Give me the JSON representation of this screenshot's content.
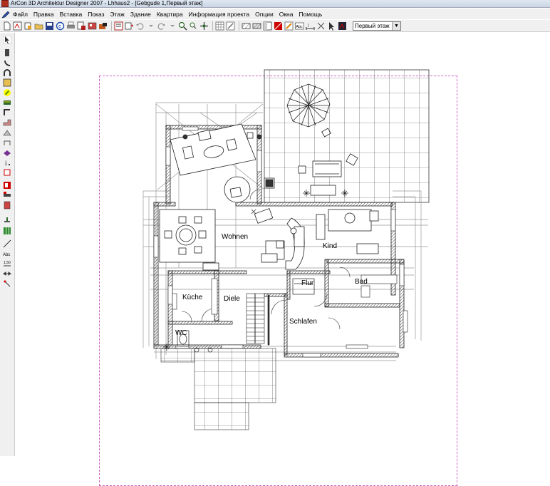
{
  "window": {
    "title": "ArCon 3D Architektur Designer 2007  - Lhhaus2 - [Gebgude 1,Первый этаж]"
  },
  "menu": {
    "items": [
      "Файл",
      "Правка",
      "Вставка",
      "Показ",
      "Этаж",
      "Здание",
      "Квартира",
      "Информация проекта",
      "Опции",
      "Окна",
      "Помощь"
    ]
  },
  "toolbar": {
    "floor_select_value": "Первый этаж",
    "abc_label": "Abc"
  },
  "lefttoolbar": {
    "abc_label": "Abc",
    "dim_label": "1,50"
  },
  "plan": {
    "rooms": {
      "wohnen": "Wohnen",
      "kind": "Kind",
      "kueche": "Küche",
      "diele": "Diele",
      "flur": "Flur",
      "bad": "Bad",
      "schlafen": "Schlafen",
      "wc": "WC"
    }
  },
  "colors": {
    "sheet_border": "#d060c0",
    "wall_hatch": "#444444",
    "chrome": "#f0f0f0"
  }
}
